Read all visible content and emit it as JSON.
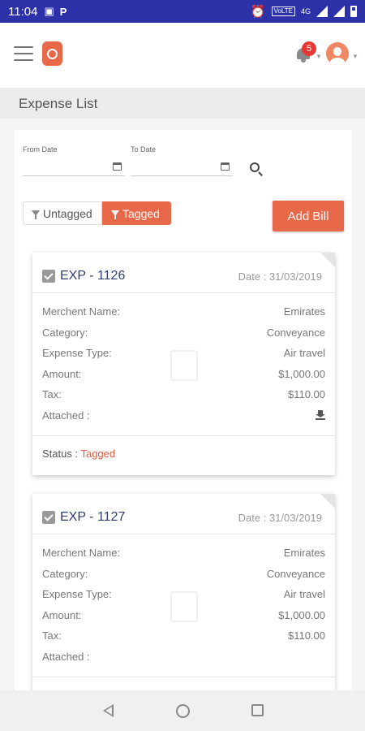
{
  "status_bar": {
    "time": "11:04",
    "volte": "VoLTE",
    "network": "4G"
  },
  "header": {
    "notification_count": "5"
  },
  "page": {
    "title": "Expense List"
  },
  "filters": {
    "from_label": "From Date",
    "to_label": "To Date",
    "untagged_label": "Untagged",
    "tagged_label": "Tagged",
    "add_bill_label": "Add Bill"
  },
  "labels": {
    "merchant": "Merchent Name:",
    "category": "Category:",
    "expense_type": "Expense Type:",
    "amount": "Amount:",
    "tax": "Tax:",
    "attached": "Attached :",
    "status": "Status : "
  },
  "expenses": [
    {
      "id": "EXP - 1126",
      "date": "Date : 31/03/2019",
      "merchant": "Emirates",
      "category": "Conveyance",
      "expense_type": "Air travel",
      "amount": "$1,000.00",
      "tax": "$110.00",
      "status": "Tagged"
    },
    {
      "id": "EXP - 1127",
      "date": "Date : 31/03/2019",
      "merchant": "Emirates",
      "category": "Conveyance",
      "expense_type": "Air travel",
      "amount": "$1,000.00",
      "tax": "$110.00"
    }
  ],
  "colors": {
    "accent": "#e8684a",
    "status_bar": "#2c31a8",
    "id_text": "#2f3e6e"
  }
}
